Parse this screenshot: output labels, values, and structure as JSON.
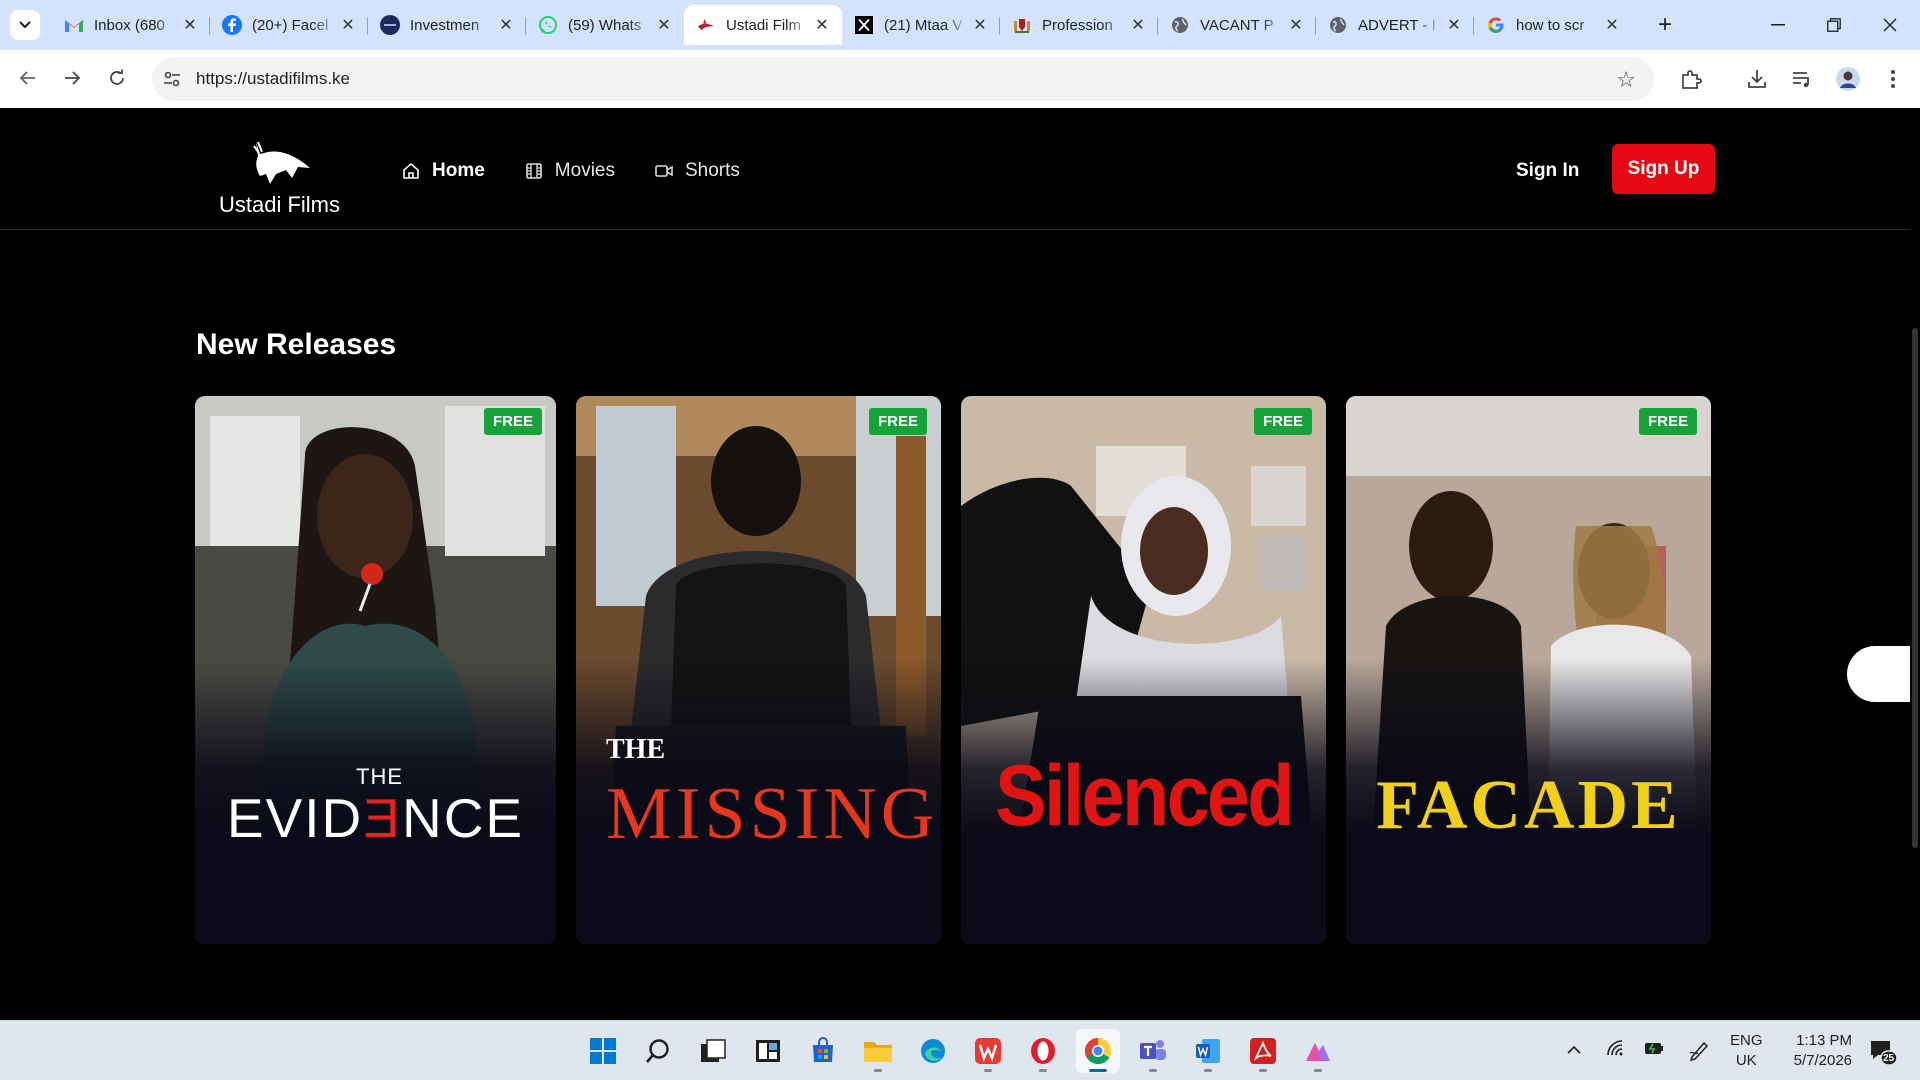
{
  "browser": {
    "tabs": [
      {
        "title": "Inbox (680",
        "icon": "gmail-icon"
      },
      {
        "title": "(20+) Facel",
        "icon": "facebook-icon"
      },
      {
        "title": "Investmen",
        "icon": "tsavo-icon"
      },
      {
        "title": "(59) Whats",
        "icon": "whatsapp-icon"
      },
      {
        "title": "Ustadi Film",
        "icon": "ustadi-icon",
        "active": true
      },
      {
        "title": "(21) Mtaa V",
        "icon": "x-icon"
      },
      {
        "title": "Profession",
        "icon": "coat-of-arms-icon"
      },
      {
        "title": "VACANT P",
        "icon": "globe-icon"
      },
      {
        "title": "ADVERT - I",
        "icon": "globe-icon"
      },
      {
        "title": "how to scr",
        "icon": "google-icon"
      }
    ],
    "url": "https://ustadifilms.ke"
  },
  "site": {
    "brand": "Ustadi Films",
    "nav": [
      {
        "label": "Home",
        "icon": "home-icon"
      },
      {
        "label": "Movies",
        "icon": "film-icon"
      },
      {
        "label": "Shorts",
        "icon": "video-icon"
      }
    ],
    "sign_in": "Sign In",
    "sign_up": "Sign Up"
  },
  "main": {
    "section_title": "New Releases",
    "movies": [
      {
        "title_pre": "THE",
        "title": "EVIDENCE",
        "title_display": [
          "EVID",
          "Ǝ",
          "NCE"
        ],
        "badge": "FREE"
      },
      {
        "title_pre": "THE",
        "title": "MISSING",
        "badge": "FREE"
      },
      {
        "title": "Silenced",
        "badge": "FREE"
      },
      {
        "title": "FACADE",
        "badge": "FREE"
      }
    ]
  },
  "taskbar": {
    "language": "ENG",
    "region": "UK",
    "time": "1:13 PM",
    "date": "5/7/2026",
    "notifications": "25"
  },
  "colors": {
    "accent_red": "#e50914",
    "free_badge": "#15a33a",
    "chrome_tabstrip": "#d3e3fd"
  }
}
